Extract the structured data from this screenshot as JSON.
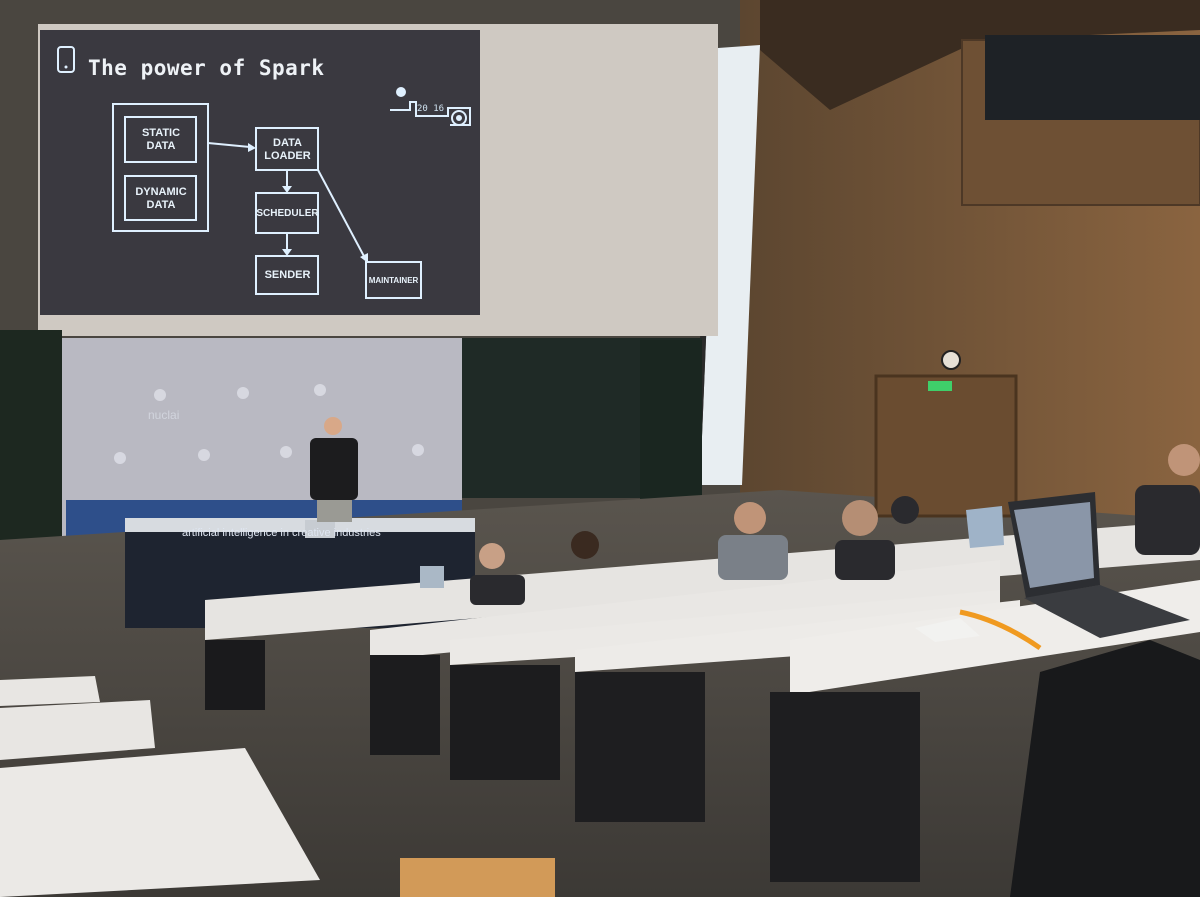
{
  "slide": {
    "title": "The power of Spark",
    "year_badge": "20 16",
    "boxes": {
      "static_data": "STATIC DATA",
      "dynamic_data": "DYNAMIC DATA",
      "data_loader": "DATA LOADER",
      "scheduler": "SCHEDULER",
      "sender": "SENDER",
      "maintainer": "MAINTAINER"
    }
  },
  "backdrop": {
    "brand": "nuclai",
    "tagline": "artificial intelligence in creative industries"
  },
  "colors": {
    "slide_bg": "#3a3940",
    "slide_line": "#dff0ff",
    "wood": "#7a5a3c",
    "desk": "#e9e7e4"
  }
}
